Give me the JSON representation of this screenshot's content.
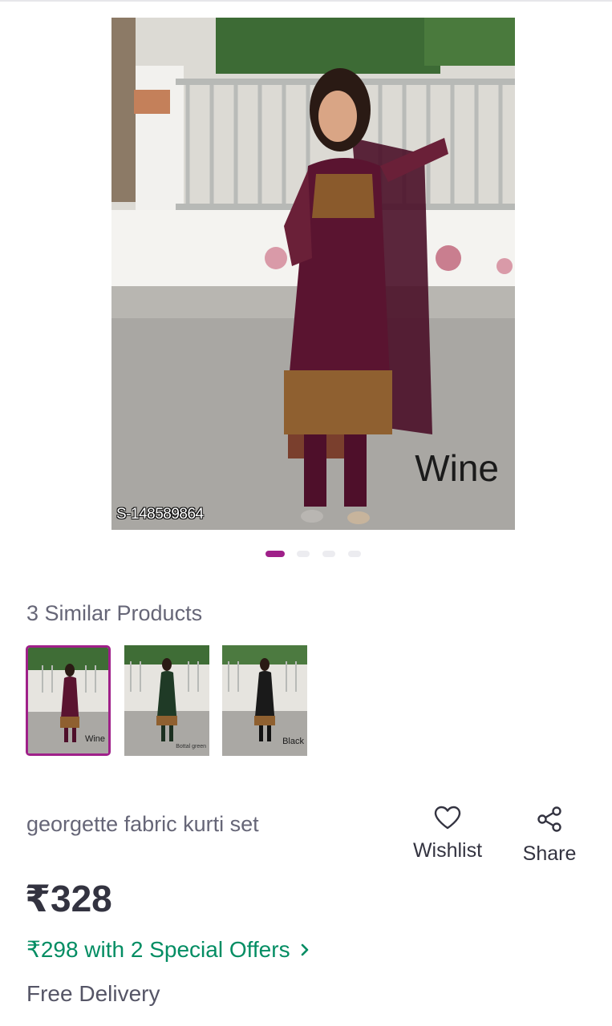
{
  "product": {
    "image_watermark": "S-148589864",
    "image_color_label": "Wine",
    "carousel": {
      "count": 4,
      "active_index": 0
    },
    "similar_title": "3 Similar Products",
    "similar": [
      {
        "label": "Wine"
      },
      {
        "label": "Bottal green"
      },
      {
        "label": "Black"
      }
    ],
    "name": "georgette fabric kurti set",
    "price": "₹328",
    "offer_text": "₹298 with 2 Special Offers",
    "delivery": "Free Delivery"
  },
  "actions": {
    "wishlist_label": "Wishlist",
    "share_label": "Share"
  },
  "colors": {
    "accent": "#9f2089",
    "offer_green": "#038d63",
    "wine": "#5a1430",
    "green": "#1f3a26",
    "black": "#1a1a1a"
  },
  "icons": [
    "heart-icon",
    "share-icon",
    "chevron-right-icon"
  ]
}
